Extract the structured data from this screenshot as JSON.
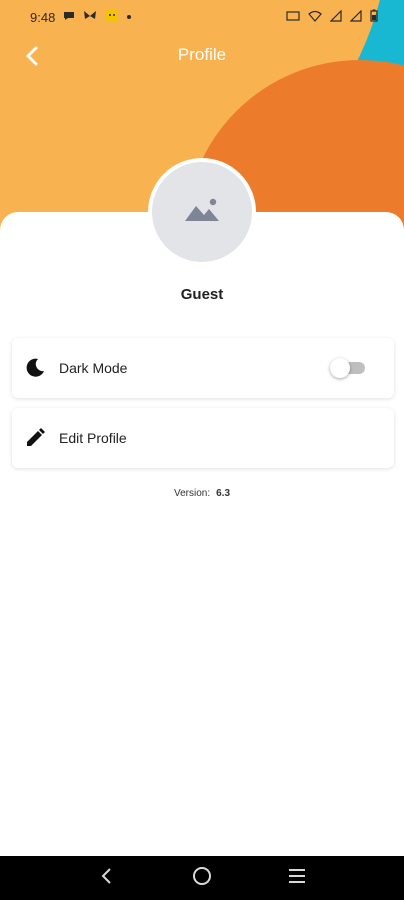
{
  "status_bar": {
    "time": "9:48",
    "notification_icons": [
      "chat-bubble-icon",
      "butterfly-icon",
      "emoji-icon"
    ],
    "system_icons": [
      "nfc-icon",
      "wifi-icon",
      "signal-icon",
      "signal-icon",
      "battery-icon"
    ]
  },
  "header": {
    "title": "Profile",
    "back_icon": "chevron-left-icon"
  },
  "profile": {
    "avatar_icon": "image-placeholder-icon",
    "name": "Guest"
  },
  "settings": {
    "dark_mode": {
      "label": "Dark Mode",
      "icon": "moon-icon",
      "enabled": false
    },
    "edit_profile": {
      "label": "Edit Profile",
      "icon": "pencil-icon"
    }
  },
  "footer": {
    "version_label": "Version:",
    "version_value": "6.3"
  },
  "nav": {
    "back_icon": "nav-back-icon",
    "home_icon": "nav-home-icon",
    "menu_icon": "nav-menu-icon"
  },
  "colors": {
    "header_orange_light": "#F8B24F",
    "header_cyan": "#19B8D2",
    "header_orange_dark": "#EC7B2C",
    "toggle_off_track": "#BFBFBF"
  }
}
